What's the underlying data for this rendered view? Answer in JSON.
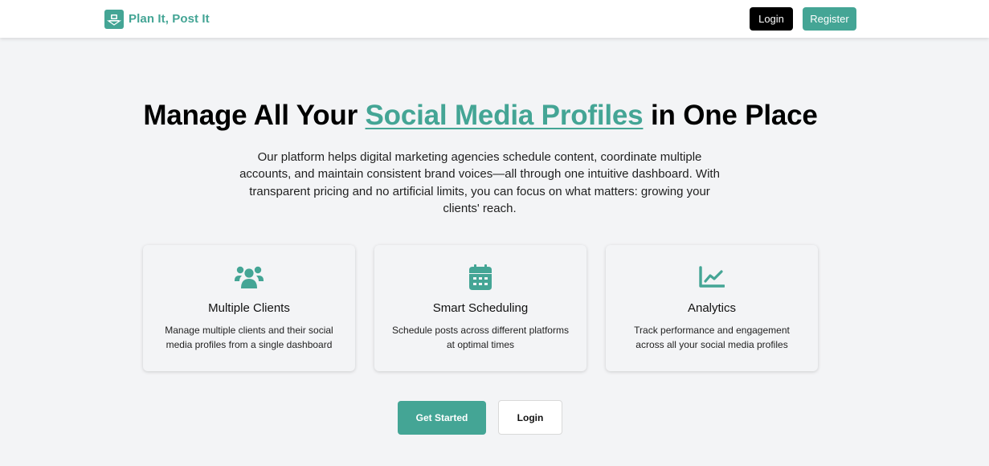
{
  "header": {
    "brand_name": "Plan It, Post It",
    "brand_icon": "laptop-icon",
    "login_label": "Login",
    "register_label": "Register"
  },
  "hero": {
    "title_prefix": "Manage All Your ",
    "title_highlight": "Social Media Profiles",
    "title_suffix": " in One Place",
    "description": "Our platform helps digital marketing agencies schedule content, coordinate multiple accounts, and maintain consistent brand voices—all through one intuitive dashboard. With transparent pricing and no artificial limits, you can focus on what matters: growing your clients' reach."
  },
  "features": [
    {
      "icon": "users-icon",
      "title": "Multiple Clients",
      "description": "Manage multiple clients and their social media profiles from a single dashboard"
    },
    {
      "icon": "calendar-icon",
      "title": "Smart Scheduling",
      "description": "Schedule posts across different platforms at optimal times"
    },
    {
      "icon": "chart-line-icon",
      "title": "Analytics",
      "description": "Track performance and engagement across all your social media profiles"
    }
  ],
  "cta": {
    "get_started_label": "Get Started",
    "login_label": "Login"
  },
  "colors": {
    "accent": "#44a595",
    "background": "#f3f4f6",
    "login_button": "#000000"
  }
}
